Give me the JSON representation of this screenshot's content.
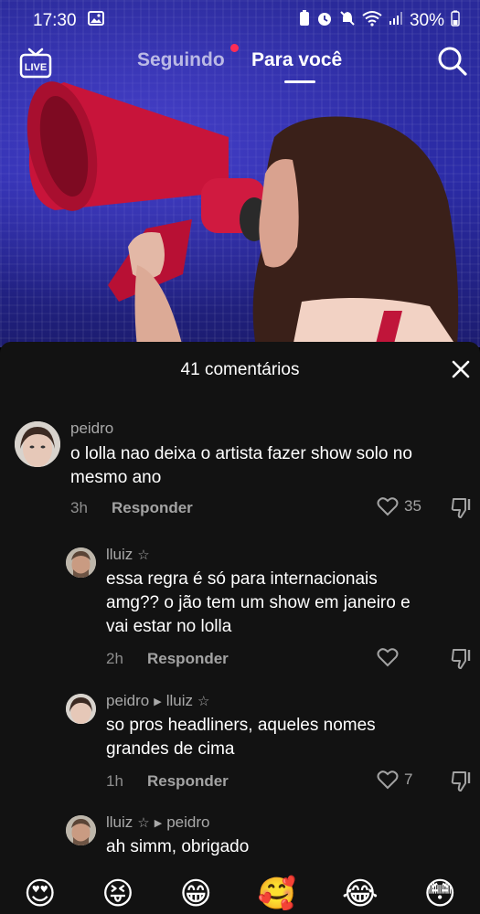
{
  "status_bar": {
    "time": "17:30",
    "battery": "30%"
  },
  "topnav": {
    "live_label": "LIVE",
    "tab_following": "Seguindo",
    "tab_for_you": "Para você"
  },
  "comments_sheet": {
    "title": "41 comentários",
    "comments": [
      {
        "username": "peidro",
        "text_line1": "o lolla nao deixa o artista fazer show solo no",
        "text_line2": "mesmo ano",
        "time": "3h",
        "reply_label": "Responder",
        "likes": "35"
      },
      {
        "username": "lluiz",
        "star": "☆",
        "text_line1": "essa regra é só para internacionais",
        "text_line2": "amg?? o jão tem um show em janeiro e",
        "text_line3": "vai estar no lolla",
        "time": "2h",
        "reply_label": "Responder"
      },
      {
        "username": "peidro",
        "reply_to": "lluiz",
        "star": "☆",
        "text_line1": "so pros headliners, aqueles nomes",
        "text_line2": "grandes de cima",
        "time": "1h",
        "reply_label": "Responder",
        "likes": "7"
      },
      {
        "username": "lluiz",
        "star": "☆",
        "reply_to": "peidro",
        "text_line1": "ah simm, obrigado"
      }
    ]
  },
  "emoji_bar": [
    "😍",
    "😝",
    "😁",
    "🥰",
    "😂",
    "😳"
  ],
  "colors": {
    "accent": "#fe2c55",
    "sheet_bg": "#121212",
    "video_bg": "#2c2ca8"
  }
}
